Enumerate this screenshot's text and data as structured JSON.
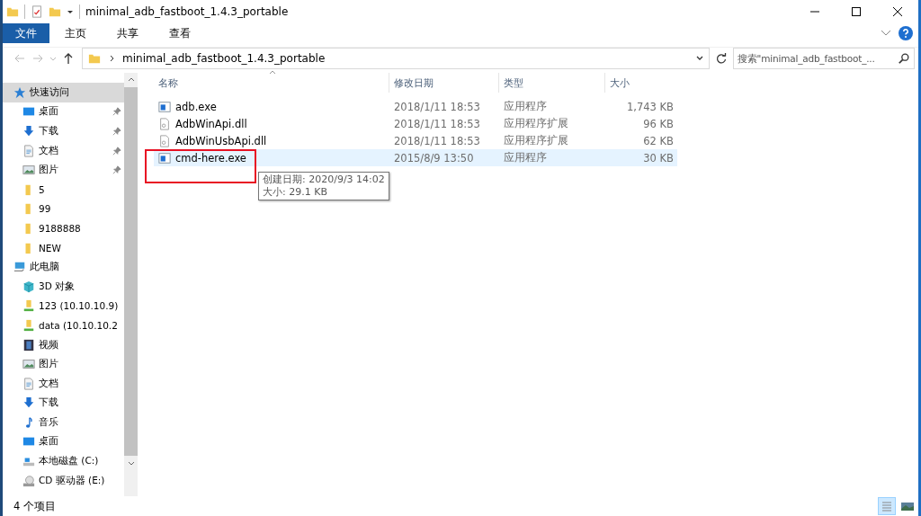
{
  "window": {
    "title": "minimal_adb_fastboot_1.4.3_portable"
  },
  "ribbon_tabs": [
    {
      "label": "文件",
      "selected": true
    },
    {
      "label": "主页",
      "selected": false
    },
    {
      "label": "共享",
      "selected": false
    },
    {
      "label": "查看",
      "selected": false
    }
  ],
  "address": {
    "path": "minimal_adb_fastboot_1.4.3_portable"
  },
  "search": {
    "placeholder": "搜索\"minimal_adb_fastboot_..."
  },
  "sidebar": {
    "items": [
      {
        "label": "快速访问",
        "kind": "star",
        "selected": true,
        "children": [
          {
            "label": "桌面",
            "kind": "desktop",
            "pinned": true
          },
          {
            "label": "下载",
            "kind": "download",
            "pinned": true
          },
          {
            "label": "文档",
            "kind": "document",
            "pinned": true
          },
          {
            "label": "图片",
            "kind": "pictures",
            "pinned": true
          },
          {
            "label": "5",
            "kind": "folder",
            "pinned": false
          },
          {
            "label": "99",
            "kind": "folder",
            "pinned": false
          },
          {
            "label": "9188888",
            "kind": "folder",
            "pinned": false
          },
          {
            "label": "NEW",
            "kind": "folder",
            "pinned": false
          }
        ]
      },
      {
        "label": "此电脑",
        "kind": "computer",
        "selected": false,
        "children": [
          {
            "label": "3D 对象",
            "kind": "cube",
            "pinned": false
          },
          {
            "label": "123 (10.10.10.9)",
            "kind": "netdrive",
            "pinned": false
          },
          {
            "label": "data (10.10.10.2",
            "kind": "netdrive",
            "pinned": false
          },
          {
            "label": "视频",
            "kind": "video",
            "pinned": false
          },
          {
            "label": "图片",
            "kind": "pictures",
            "pinned": false
          },
          {
            "label": "文档",
            "kind": "document",
            "pinned": false
          },
          {
            "label": "下载",
            "kind": "download",
            "pinned": false
          },
          {
            "label": "音乐",
            "kind": "music",
            "pinned": false
          },
          {
            "label": "桌面",
            "kind": "desktop",
            "pinned": false
          },
          {
            "label": "本地磁盘 (C:)",
            "kind": "disk",
            "pinned": false
          },
          {
            "label": "CD 驱动器 (E:)",
            "kind": "cd",
            "pinned": false
          }
        ]
      }
    ]
  },
  "table": {
    "columns": [
      "名称",
      "修改日期",
      "类型",
      "大小"
    ],
    "rows": [
      {
        "name": "adb.exe",
        "kind": "exe",
        "date": "2018/1/11 18:53",
        "type": "应用程序",
        "size": "1,743 KB",
        "selected": false,
        "highlighted": false
      },
      {
        "name": "AdbWinApi.dll",
        "kind": "dll",
        "date": "2018/1/11 18:53",
        "type": "应用程序扩展",
        "size": "96 KB",
        "selected": false,
        "highlighted": false
      },
      {
        "name": "AdbWinUsbApi.dll",
        "kind": "dll",
        "date": "2018/1/11 18:53",
        "type": "应用程序扩展",
        "size": "62 KB",
        "selected": false,
        "highlighted": false
      },
      {
        "name": "cmd-here.exe",
        "kind": "exe",
        "date": "2015/8/9 13:50",
        "type": "应用程序",
        "size": "30 KB",
        "selected": true,
        "highlighted": true
      }
    ]
  },
  "tooltip": {
    "lines": [
      "创建日期: 2020/9/3 14:02",
      "大小: 29.1 KB"
    ]
  },
  "status_bar": {
    "text": "4 个项目"
  }
}
